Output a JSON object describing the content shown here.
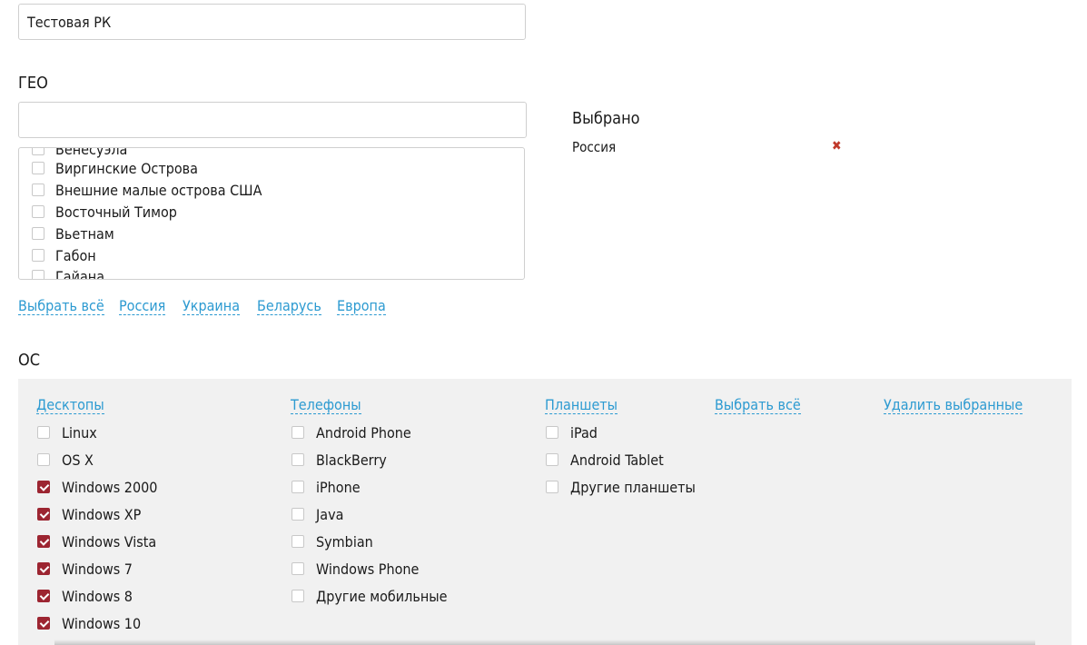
{
  "campaign": {
    "name_value": "Тестовая РК"
  },
  "geo": {
    "heading": "ГЕО",
    "search_value": "",
    "list_items": [
      {
        "label": "Венесуэла",
        "checked": false
      },
      {
        "label": "Виргинские Острова",
        "checked": false
      },
      {
        "label": "Внешние малые острова США",
        "checked": false
      },
      {
        "label": "Восточный Тимор",
        "checked": false
      },
      {
        "label": "Вьетнам",
        "checked": false
      },
      {
        "label": "Габон",
        "checked": false
      },
      {
        "label": "Гайана",
        "checked": false
      }
    ],
    "quick_links": [
      "Выбрать всё",
      "Россия",
      "Украина",
      "Беларусь",
      "Европа"
    ],
    "selected": {
      "title": "Выбрано",
      "items": [
        {
          "label": "Россия",
          "remove_icon": "close-icon"
        }
      ]
    }
  },
  "os": {
    "heading": "ОС",
    "groups": [
      {
        "title": "Десктопы",
        "items": [
          {
            "label": "Linux",
            "checked": false
          },
          {
            "label": "OS X",
            "checked": false
          },
          {
            "label": "Windows 2000",
            "checked": true
          },
          {
            "label": "Windows XP",
            "checked": true
          },
          {
            "label": "Windows Vista",
            "checked": true
          },
          {
            "label": "Windows 7",
            "checked": true
          },
          {
            "label": "Windows 8",
            "checked": true
          },
          {
            "label": "Windows 10",
            "checked": true
          }
        ]
      },
      {
        "title": "Телефоны",
        "items": [
          {
            "label": "Android Phone",
            "checked": false
          },
          {
            "label": "BlackBerry",
            "checked": false
          },
          {
            "label": "iPhone",
            "checked": false
          },
          {
            "label": "Java",
            "checked": false
          },
          {
            "label": "Symbian",
            "checked": false
          },
          {
            "label": "Windows Phone",
            "checked": false
          },
          {
            "label": "Другие мобильные",
            "checked": false
          }
        ]
      },
      {
        "title": "Планшеты",
        "items": [
          {
            "label": "iPad",
            "checked": false
          },
          {
            "label": "Android Tablet",
            "checked": false
          },
          {
            "label": "Другие планшеты",
            "checked": false
          }
        ]
      }
    ],
    "select_all": "Выбрать всё",
    "remove_selected": "Удалить выбранные"
  },
  "colors": {
    "link": "#2c9ad1",
    "checkbox_checked": "#9c2531",
    "remove_x": "#c0392b",
    "panel_bg": "#f1f1f1"
  }
}
